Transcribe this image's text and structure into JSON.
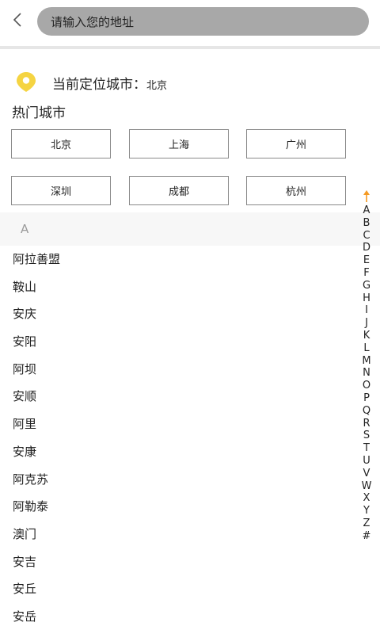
{
  "header": {
    "back_icon": "chevron-left-icon",
    "search_placeholder": "请输入您的地址"
  },
  "location": {
    "icon": "location-pin-icon",
    "icon_color": "#f5d442",
    "label": "当前定位城市：",
    "city": "北京"
  },
  "hot": {
    "title": "热门城市",
    "cities": [
      "北京",
      "上海",
      "广州",
      "深圳",
      "成都",
      "杭州"
    ]
  },
  "section": {
    "header": "A"
  },
  "cities": [
    "阿拉善盟",
    "鞍山",
    "安庆",
    "安阳",
    "阿坝",
    "安顺",
    "阿里",
    "安康",
    "阿克苏",
    "阿勒泰",
    "澳门",
    "安吉",
    "安丘",
    "安岳"
  ],
  "index": {
    "top_icon": "arrow-up-icon",
    "top_icon_color": "#f59a23",
    "letters": [
      "A",
      "B",
      "C",
      "D",
      "E",
      "F",
      "G",
      "H",
      "I",
      "J",
      "K",
      "L",
      "M",
      "N",
      "O",
      "P",
      "Q",
      "R",
      "S",
      "T",
      "U",
      "V",
      "W",
      "X",
      "Y",
      "Z",
      "#"
    ]
  }
}
